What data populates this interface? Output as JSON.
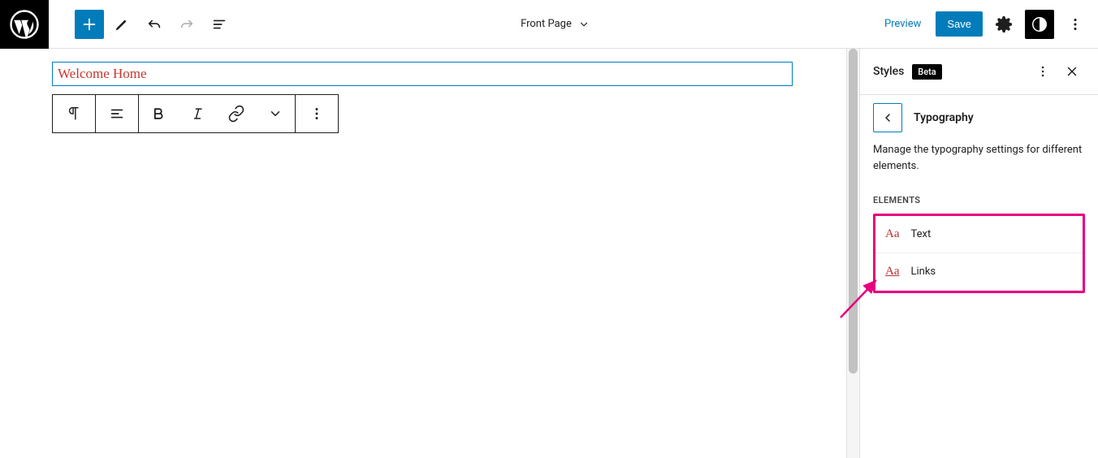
{
  "topbar": {
    "page_title": "Front Page",
    "preview_label": "Preview",
    "save_label": "Save"
  },
  "editor": {
    "heading_text": "Welcome Home"
  },
  "sidebar": {
    "title": "Styles",
    "badge": "Beta",
    "nav_title": "Typography",
    "description": "Manage the typography settings for different elements.",
    "section_label": "ELEMENTS",
    "elements": [
      {
        "icon": "Aa",
        "label": "Text"
      },
      {
        "icon": "Aa",
        "label": "Links"
      }
    ]
  }
}
